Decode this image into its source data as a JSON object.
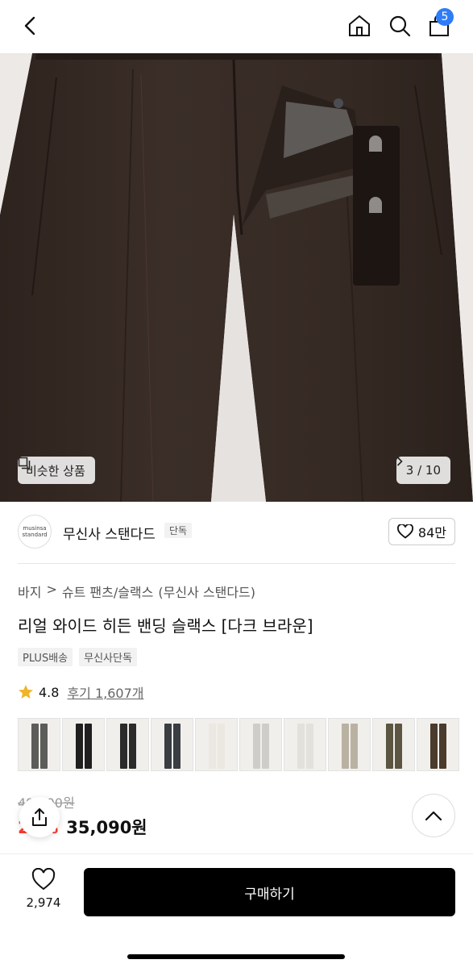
{
  "header": {
    "back_icon": "chevron-left-icon",
    "home_icon": "home-icon",
    "search_icon": "search-icon",
    "cart_icon": "cart-icon",
    "cart_count": "5"
  },
  "hero": {
    "similar_label": "비슷한 상품",
    "page_counter": "3 / 10",
    "image_alt": "dark brown wide slacks"
  },
  "brand": {
    "logo_line1": "musinsa",
    "logo_line2": "standard",
    "name": "무신사 스탠다드",
    "badge": "단독",
    "like_count": "84만"
  },
  "product": {
    "breadcrumb": [
      "바지",
      ">",
      "슈트 팬츠/슬랙스",
      "(무신사 스탠다드)"
    ],
    "title": "리얼 와이드 히든 밴딩 슬랙스 [다크 브라운]",
    "tags": [
      "PLUS배송",
      "무신사단독"
    ],
    "rating": "4.8",
    "reviews": "후기 1,607개"
  },
  "swatches": [
    {
      "color": "#5c5c5a"
    },
    {
      "color": "#1f1f1f"
    },
    {
      "color": "#2b2b2b"
    },
    {
      "color": "#3a3d42"
    },
    {
      "color": "#ebe8e1"
    },
    {
      "color": "#cfcdca"
    },
    {
      "color": "#e3e1dc"
    },
    {
      "color": "#b9b2a3"
    },
    {
      "color": "#5b5541"
    },
    {
      "color": "#4a3b2c"
    }
  ],
  "price": {
    "original": "49,900원",
    "discount": "29%",
    "sale": "35,090원"
  },
  "bottom": {
    "wish_count": "2,974",
    "buy_label": "구매하기"
  },
  "colors": {
    "accent_red": "#ff3b30",
    "badge_blue": "#2f7cf6",
    "pants": "#3a2d27"
  }
}
